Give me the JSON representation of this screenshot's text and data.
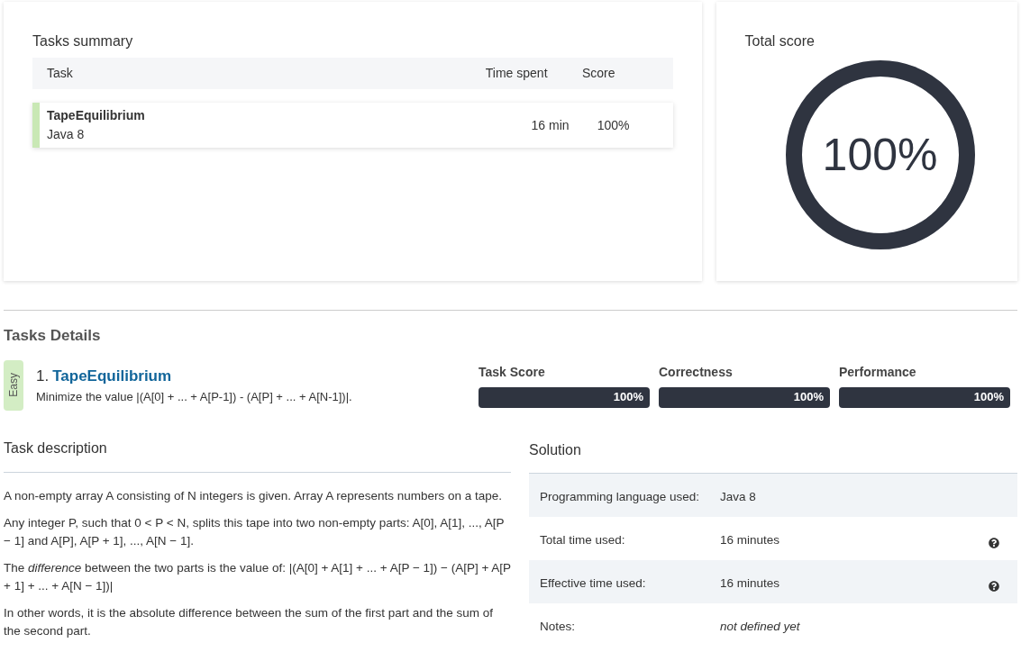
{
  "summary": {
    "title": "Tasks summary",
    "columns": [
      "Task",
      "Time spent",
      "Score"
    ],
    "rows": [
      {
        "task": "TapeEquilibrium",
        "language": "Java 8",
        "time": "16 min",
        "score": "100%",
        "color": "#c9e8b5"
      }
    ]
  },
  "total": {
    "title": "Total score",
    "value": "100%"
  },
  "details": {
    "title": "Tasks Details",
    "task": {
      "difficulty": "Easy",
      "color": "#d3edc4",
      "number": "1.",
      "name": "TapeEquilibrium",
      "summary": "Minimize the value |(A[0] + ... + A[P-1]) - (A[P] + ... + A[N-1])|.",
      "metrics": [
        {
          "label": "Task Score",
          "reading": "100%"
        },
        {
          "label": "Correctness",
          "reading": "100%"
        },
        {
          "label": "Performance",
          "reading": "100%"
        }
      ]
    }
  },
  "description": {
    "title": "Task description",
    "paragraphs": [
      "A non-empty array A consisting of N integers is given. Array A represents numbers on a tape.",
      "Any integer P, such that 0 < P < N, splits this tape into two non-empty parts: A[0], A[1], ..., A[P − 1] and A[P], A[P + 1], ..., A[N − 1].",
      "The *difference* between the two parts is the value of: |(A[0] + A[1] + ... + A[P − 1]) − (A[P] + A[P + 1] + ... + A[N − 1])|",
      "In other words, it is the absolute difference between the sum of the first part and the sum of the second part."
    ]
  },
  "solution": {
    "title": "Solution",
    "rows": [
      {
        "label": "Programming language used:",
        "value": "Java 8",
        "help": false,
        "italic": false
      },
      {
        "label": "Total time used:",
        "value": "16 minutes",
        "help": true,
        "italic": false
      },
      {
        "label": "Effective time used:",
        "value": "16 minutes",
        "help": true,
        "italic": false
      },
      {
        "label": "Notes:",
        "value": "not defined yet",
        "help": false,
        "italic": true
      }
    ]
  }
}
